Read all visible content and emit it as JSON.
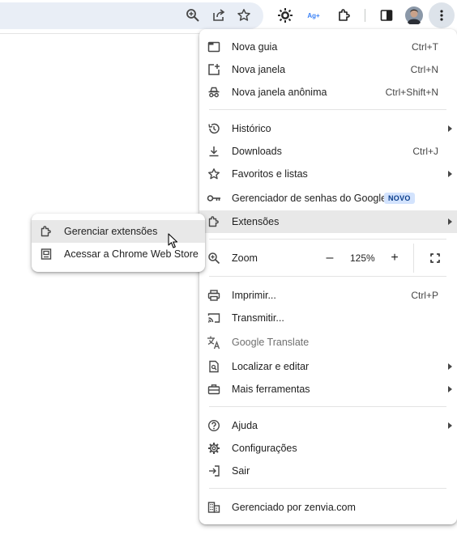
{
  "toolbar": {
    "icons": [
      "zoom-icon",
      "share-icon",
      "bookmark-star-icon",
      "extension-puzzle-icon",
      "translate-extension-icon",
      "extensions-icon",
      "side-panel-icon",
      "profile-avatar",
      "kebab-menu-icon"
    ],
    "translate_icon_text": "Ag+"
  },
  "menu": {
    "new_tab": {
      "label": "Nova guia",
      "shortcut": "Ctrl+T"
    },
    "new_window": {
      "label": "Nova janela",
      "shortcut": "Ctrl+N"
    },
    "incognito": {
      "label": "Nova janela anônima",
      "shortcut": "Ctrl+Shift+N"
    },
    "history": {
      "label": "Histórico"
    },
    "downloads": {
      "label": "Downloads",
      "shortcut": "Ctrl+J"
    },
    "bookmarks": {
      "label": "Favoritos e listas"
    },
    "passwords": {
      "label": "Gerenciador de senhas do Google",
      "badge": "NOVO"
    },
    "extensions": {
      "label": "Extensões"
    },
    "zoom": {
      "label": "Zoom",
      "minus": "–",
      "value": "125%",
      "plus": "+"
    },
    "print": {
      "label": "Imprimir...",
      "shortcut": "Ctrl+P"
    },
    "cast": {
      "label": "Transmitir..."
    },
    "translate": {
      "label": "Google Translate"
    },
    "find": {
      "label": "Localizar e editar"
    },
    "more_tools": {
      "label": "Mais ferramentas"
    },
    "help": {
      "label": "Ajuda"
    },
    "settings": {
      "label": "Configurações"
    },
    "exit": {
      "label": "Sair"
    },
    "managed": {
      "label": "Gerenciado por zenvia.com"
    }
  },
  "submenu": {
    "manage_extensions": {
      "label": "Gerenciar extensões"
    },
    "web_store": {
      "label": "Acessar a Chrome Web Store"
    }
  },
  "colors": {
    "accent": "#0b57d0",
    "hover": "#e8e8e8",
    "badge_bg": "#d3e3fd"
  }
}
